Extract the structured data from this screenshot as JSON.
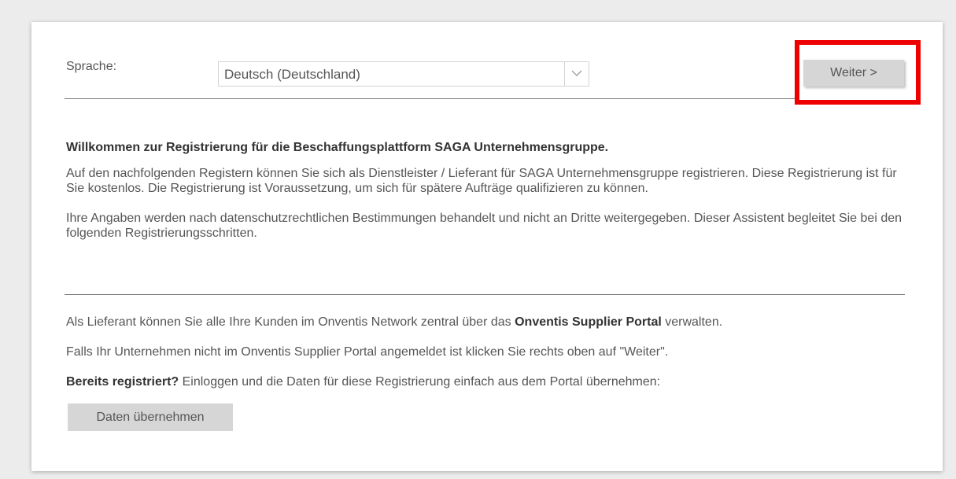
{
  "language": {
    "label": "Sprache:",
    "selected": "Deutsch (Deutschland)"
  },
  "toolbar": {
    "next_label": "Weiter >"
  },
  "intro": {
    "heading": "Willkommen zur Registrierung für die Beschaffungsplattform SAGA Unternehmensgruppe.",
    "paragraph1": "Auf den nachfolgenden Registern können Sie sich als Dienstleister / Lieferant für SAGA Unternehmensgruppe registrieren. Diese Registrierung ist für Sie kostenlos. Die Registrierung ist Voraussetzung, um sich für spätere Aufträge qualifizieren zu können.",
    "paragraph2": "Ihre Angaben werden nach datenschutzrechtlichen Bestimmungen behandelt und nicht an Dritte weitergegeben. Dieser Assistent begleitet Sie bei den folgenden Registrierungsschritten."
  },
  "portal": {
    "line1_pre": "Als Lieferant können Sie alle Ihre Kunden im Onventis Network zentral über das ",
    "line1_bold": "Onventis Supplier Portal",
    "line1_post": " verwalten.",
    "line2": "Falls Ihr Unternehmen nicht im Onventis Supplier Portal angemeldet ist klicken Sie rechts oben auf \"Weiter\".",
    "registered_bold": "Bereits registriert?",
    "registered_text": " Einloggen und die Daten für diese Registrierung einfach aus dem Portal übernehmen:",
    "import_button": "Daten übernehmen"
  },
  "colors": {
    "highlight": "#ee0000",
    "button_bg": "#d6d6d6",
    "page_bg": "#ececec"
  },
  "icons": {
    "dropdown": "chevron-down-icon"
  }
}
